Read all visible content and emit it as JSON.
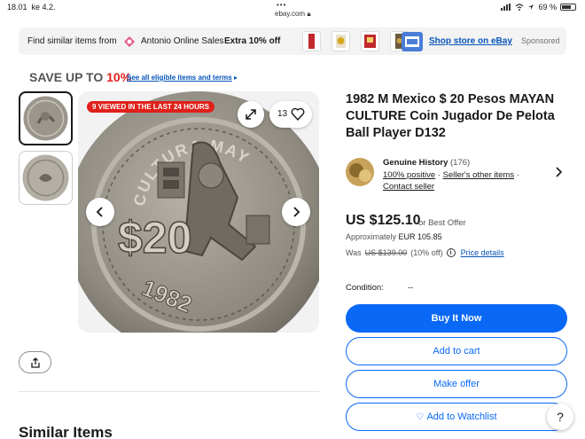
{
  "status_bar": {
    "time": "18.01",
    "date": "ke 4.2.",
    "url": "ebay.com",
    "battery": "69 %"
  },
  "banner": {
    "find_label": "Find similar items from",
    "seller_name": "Antonio Online Sales",
    "discount": "Extra 10% off",
    "shop_link": "Shop store on eBay",
    "sponsored": "Sponsored"
  },
  "promo": {
    "save_prefix": "SAVE UP TO ",
    "save_pct": "10%",
    "link": "See all eligible items and terms"
  },
  "gallery": {
    "viewed_badge": "9 VIEWED IN THE LAST 24 HOURS",
    "watch_count": "13",
    "coin": {
      "top_text": "CULTURA MAYA",
      "value": "$20",
      "year": "1982"
    }
  },
  "similar_heading": "Similar Items",
  "item": {
    "title": "1982 M Mexico $ 20 Pesos MAYAN CULTURE Coin Jugador De Pelota Ball Player D132",
    "seller": {
      "name": "Genuine History",
      "count": "(176)",
      "feedback": "100% positive",
      "other_items": "Seller's other items",
      "contact": "Contact seller"
    },
    "price": "US $125.10",
    "offer": "or Best Offer",
    "approx_label": "Approximately",
    "approx_value": "EUR 105.85",
    "was_label": "Was",
    "was_price": "US $139.00",
    "was_off": "(10% off)",
    "price_details": "Price details",
    "condition_label": "Condition:",
    "condition_value": "--"
  },
  "buttons": {
    "buy": "Buy It Now",
    "cart": "Add to cart",
    "offer": "Make offer",
    "watch": "Add to Watchlist"
  },
  "colors": {
    "accent": "#0968f6",
    "link": "#0654ba",
    "red": "#e0201b"
  }
}
